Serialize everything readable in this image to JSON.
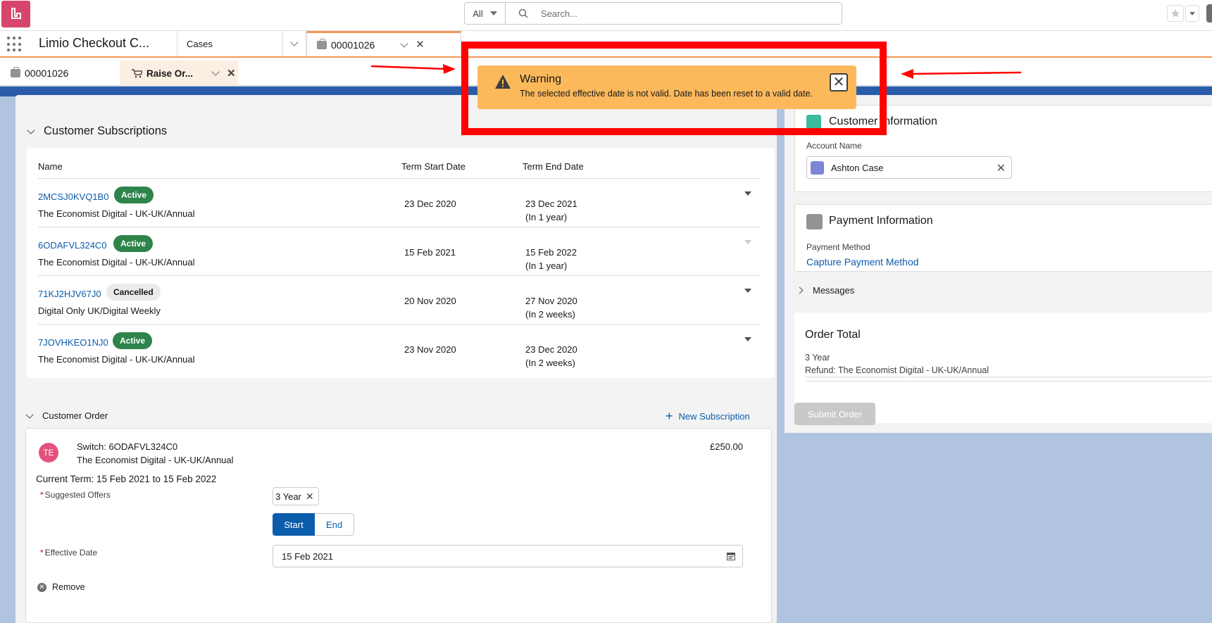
{
  "header": {
    "logo": "app-logo-icon",
    "search": {
      "scope": "All",
      "placeholder": "Search..."
    }
  },
  "nav": {
    "app_name": "Limio Checkout C...",
    "tabs": [
      {
        "label": "Cases"
      },
      {
        "label": "00001026",
        "icon": "case-icon"
      }
    ]
  },
  "subtabs": [
    {
      "label": "00001026",
      "icon": "case-icon"
    },
    {
      "label": "Raise Or...",
      "icon": "cart-icon"
    }
  ],
  "subscriptions": {
    "title": "Customer Subscriptions",
    "columns": {
      "name": "Name",
      "start": "Term Start Date",
      "end": "Term End Date"
    },
    "rows": [
      {
        "id": "2MCSJ0KVQ1B0",
        "status": "Active",
        "product": "The Economist Digital - UK-UK/Annual",
        "start": "23 Dec 2020",
        "end": "23 Dec 2021",
        "end_rel": "(In 1 year)"
      },
      {
        "id": "6ODAFVL324C0",
        "status": "Active",
        "product": "The Economist Digital - UK-UK/Annual",
        "start": "15 Feb 2021",
        "end": "15 Feb 2022",
        "end_rel": "(In 1 year)"
      },
      {
        "id": "71KJ2HJV67J0",
        "status": "Cancelled",
        "product": "Digital Only UK/Digital Weekly",
        "start": "20 Nov 2020",
        "end": "27 Nov 2020",
        "end_rel": "(In 2 weeks)"
      },
      {
        "id": "7JOVHKEO1NJ0",
        "status": "Active",
        "product": "The Economist Digital - UK-UK/Annual",
        "start": "23 Nov 2020",
        "end": "23 Dec 2020",
        "end_rel": "(In 2 weeks)"
      }
    ]
  },
  "order": {
    "title": "Customer Order",
    "new_subscription": "New Subscription",
    "item": {
      "avatar": "TE",
      "title": "Switch: 6ODAFVL324C0",
      "product": "The Economist Digital - UK-UK/Annual",
      "price": "£250.00",
      "current_term": "Current Term: 15 Feb 2021 to 15 Feb 2022",
      "offers_label": "Suggested Offers",
      "offer_value": "3 Year",
      "toggle_start": "Start",
      "toggle_end": "End",
      "date_label": "Effective Date",
      "date_value": "15 Feb 2021",
      "remove": "Remove"
    }
  },
  "right": {
    "customer": {
      "title": "Customer Information",
      "account_label": "Account Name",
      "account_name": "Ashton Case"
    },
    "payment": {
      "title": "Payment Information",
      "method_label": "Payment Method",
      "method_link": "Capture Payment Method"
    },
    "messages": "Messages",
    "total": {
      "title": "Order Total",
      "term": "3 Year",
      "line": "Refund: The Economist Digital - UK-UK/Annual"
    },
    "submit": "Submit Order"
  },
  "toast": {
    "title": "Warning",
    "message": "The selected effective date is not valid. Date has been reset to a valid date."
  },
  "colors": {
    "brand": "#0b5cab",
    "warning": "#fcb95b",
    "annotation": "#ff0000",
    "active_badge": "#2e844a"
  }
}
